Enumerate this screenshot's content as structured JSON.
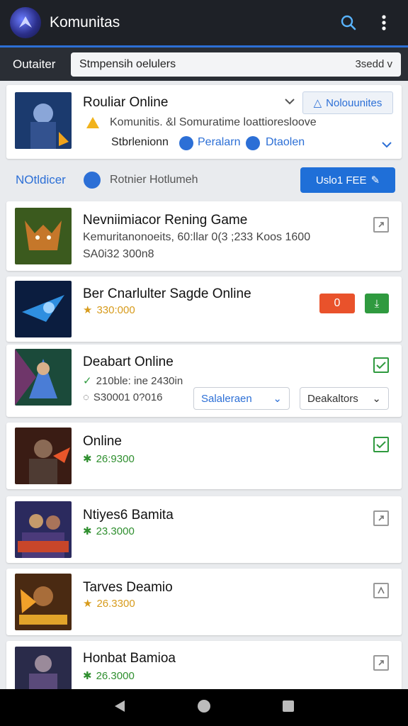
{
  "app": {
    "title": "Komunitas"
  },
  "filter": {
    "label": "Outaiter",
    "value": "Stmpensih oelulers",
    "selected": "3sedd v"
  },
  "featured": {
    "title": "Rouliar Online",
    "subtitle": "Komunitis. &l Somuratime loattioresloove",
    "tag1": "Stbrlenionn",
    "tag2": "Peralarn",
    "tag3": "Dtaolen",
    "button": "Nolouunites"
  },
  "section": {
    "left": "NOtldicer",
    "middle": "Rotnier Hotlumeh",
    "button": "Uslo1 FEE"
  },
  "games": [
    {
      "title": "Nevniimiacor Rening Game",
      "line1": "Kemuritanonoeits, 60:llar 0(3 ;233 Koos 1600",
      "line2": "SA0i32 300n8"
    },
    {
      "title": "Ber Cnarlulter Sagde Online",
      "count": "330:000",
      "badge": "0"
    },
    {
      "title": "Deabart Online",
      "line1": "210ble: ine 2430in",
      "line2": "S30001 0?016",
      "select1": "Salaleraen",
      "select2": "Deakaltors"
    },
    {
      "title": "Online",
      "count": "26:9300"
    },
    {
      "title": "Ntiyes6 Bamita",
      "count": "23.3000"
    },
    {
      "title": "Tarves Deamio",
      "count": "26.3300"
    },
    {
      "title": "Honbat Bamioa",
      "count": "26.3000"
    }
  ],
  "colors": {
    "accent": "#2c6fd6",
    "success": "#2f9a3f",
    "warn": "#e9522b",
    "star": "#e8a72a"
  },
  "icons": [
    "search-icon",
    "more-vert-icon",
    "chevron-down-icon",
    "star-icon",
    "check-icon",
    "external-link-icon",
    "back-icon",
    "home-icon",
    "recents-icon"
  ]
}
